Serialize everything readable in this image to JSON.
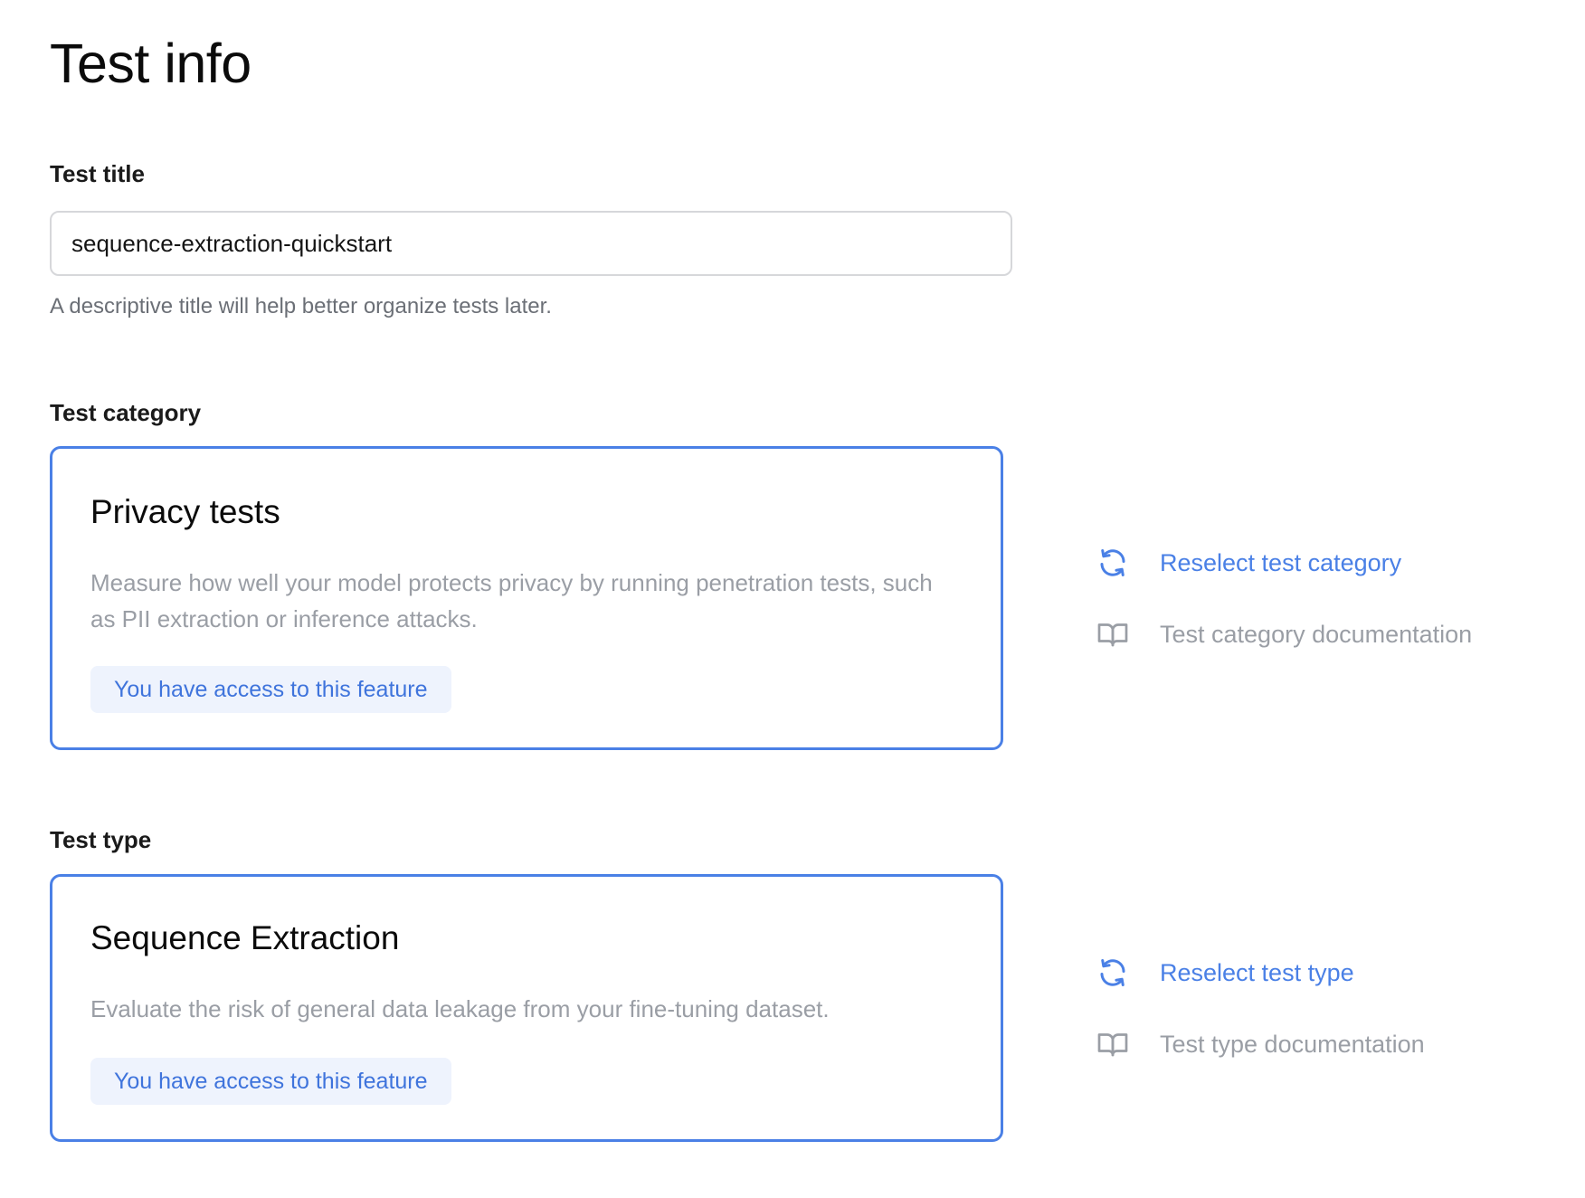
{
  "page": {
    "title": "Test info"
  },
  "test_title": {
    "label": "Test title",
    "value": "sequence-extraction-quickstart",
    "helper": "A descriptive title will help better organize tests later."
  },
  "test_category": {
    "label": "Test category",
    "card": {
      "heading": "Privacy tests",
      "description": "Measure how well your model protects privacy by running penetration tests, such as PII extraction or inference attacks.",
      "badge": "You have access to this feature"
    },
    "actions": {
      "reselect_label": "Reselect test category",
      "reselect_icon": "refresh-icon",
      "docs_label": "Test category documentation",
      "docs_icon": "book-icon"
    }
  },
  "test_type": {
    "label": "Test type",
    "card": {
      "heading": "Sequence Extraction",
      "description": "Evaluate the risk of general data leakage from your fine-tuning dataset.",
      "badge": "You have access to this feature"
    },
    "actions": {
      "reselect_label": "Reselect test type",
      "reselect_icon": "refresh-icon",
      "docs_label": "Test type documentation",
      "docs_icon": "book-icon"
    }
  },
  "colors": {
    "accent": "#4a80e6",
    "badge_bg": "#eef3fd",
    "badge_text": "#3f74dc",
    "muted_text": "#9a9ea5",
    "helper_text": "#6b6f76",
    "input_border": "#d6d7da"
  }
}
